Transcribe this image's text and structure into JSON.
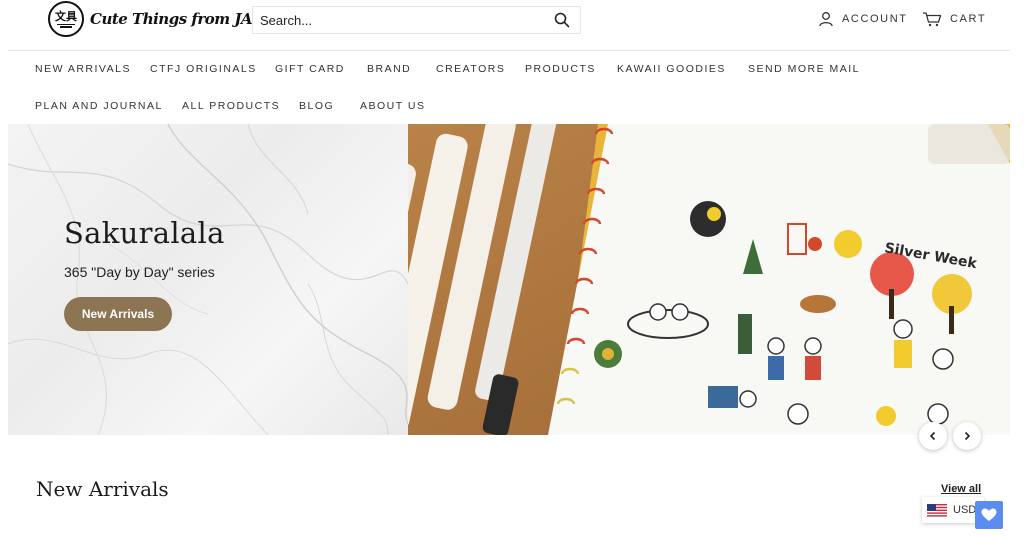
{
  "colors": {
    "accent_button": "#8d7452",
    "wishlist_button": "#5b8df1",
    "divider": "#e6e6e6"
  },
  "header": {
    "logo": {
      "badge_text": "文具",
      "name": "Cute Things from JAPAN"
    },
    "search": {
      "placeholder": "Search...",
      "icon": "search-icon"
    },
    "account": {
      "label": "ACCOUNT",
      "icon": "user-icon"
    },
    "cart": {
      "label": "CART",
      "icon": "cart-icon"
    }
  },
  "nav": {
    "row1": [
      "NEW ARRIVALS",
      "CTFJ ORIGINALS",
      "GIFT CARD",
      "BRAND",
      "CREATORS",
      "PRODUCTS",
      "KAWAII GOODIES",
      "SEND MORE MAIL"
    ],
    "row2": [
      "PLAN AND JOURNAL",
      "ALL PRODUCTS",
      "BLOG",
      "ABOUT US"
    ]
  },
  "hero": {
    "title": "Sakuralala",
    "subtitle": "365 \"Day by Day\" series",
    "button_label": "New Arrivals",
    "image_text": "Silver Week",
    "prev_icon": "chevron-left-icon",
    "next_icon": "chevron-right-icon"
  },
  "section": {
    "title": "New Arrivals",
    "view_all": "View all"
  },
  "currency": {
    "code": "USD",
    "flag_icon": "us-flag-icon"
  },
  "wishlist": {
    "icon": "heart-icon"
  }
}
